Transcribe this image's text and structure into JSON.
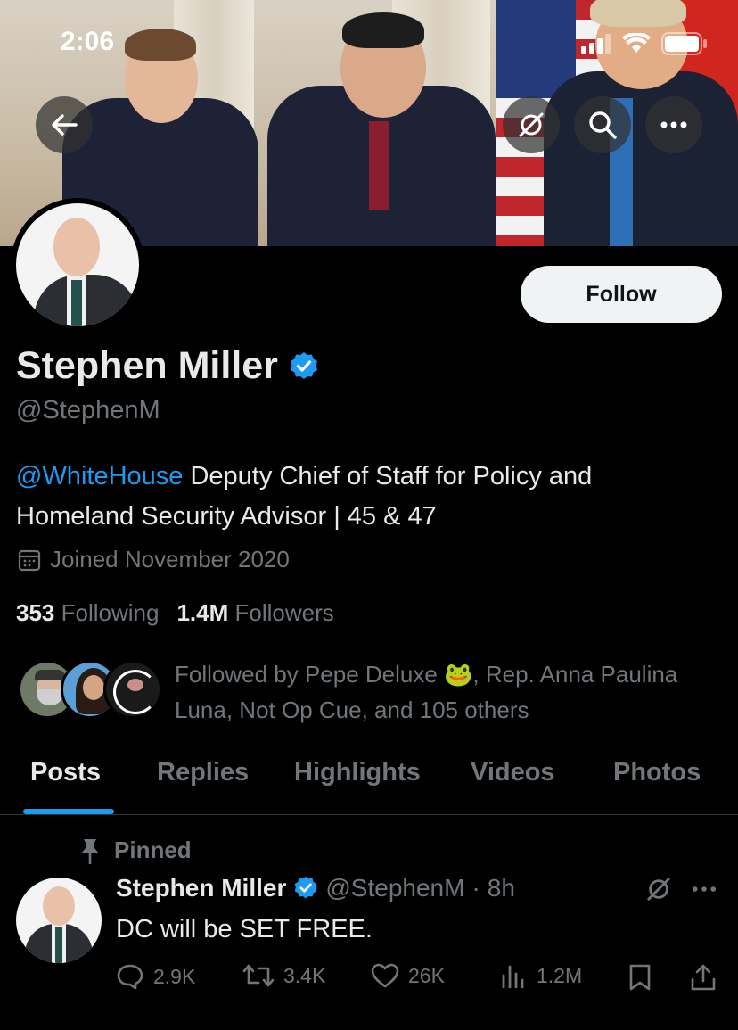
{
  "status_bar": {
    "time": "2:06"
  },
  "profile": {
    "name": "Stephen Miller",
    "handle": "@StephenM",
    "follow_label": "Follow",
    "bio_mention": "@WhiteHouse",
    "bio_line1_rest": " Deputy Chief of Staff for Policy and",
    "bio_line2": "Homeland Security Advisor | 45 & 47",
    "joined": "Joined November 2020",
    "following_count": "353",
    "following_label": "Following",
    "followers_count": "1.4M",
    "followers_label": "Followers",
    "followed_by_line1": "Followed by Pepe Deluxe 🐸, Rep. Anna Paulina",
    "followed_by_line2": "Luna, Not Op Cue, and 105 others"
  },
  "tabs": [
    {
      "label": "Posts",
      "active": true
    },
    {
      "label": "Replies"
    },
    {
      "label": "Highlights"
    },
    {
      "label": "Videos"
    },
    {
      "label": "Photos"
    }
  ],
  "pinned_post": {
    "pinned_label": "Pinned",
    "author_name": "Stephen Miller",
    "author_handle": "@StephenM",
    "separator": "·",
    "time": "8h",
    "text": "DC will be SET FREE.",
    "replies": "2.9K",
    "reposts": "3.4K",
    "likes": "26K",
    "views": "1.2M"
  },
  "colors": {
    "accent": "#1d9bf0",
    "background": "#000000",
    "text_primary": "#e7e9ea",
    "text_secondary": "#71767b",
    "verified": "#1d9bf0"
  },
  "icons": [
    "back-arrow-icon",
    "grok-icon",
    "search-icon",
    "more-icon",
    "verified-badge-icon",
    "calendar-icon",
    "pin-icon",
    "reply-icon",
    "repost-icon",
    "like-icon",
    "views-icon",
    "bookmark-icon",
    "share-icon"
  ]
}
